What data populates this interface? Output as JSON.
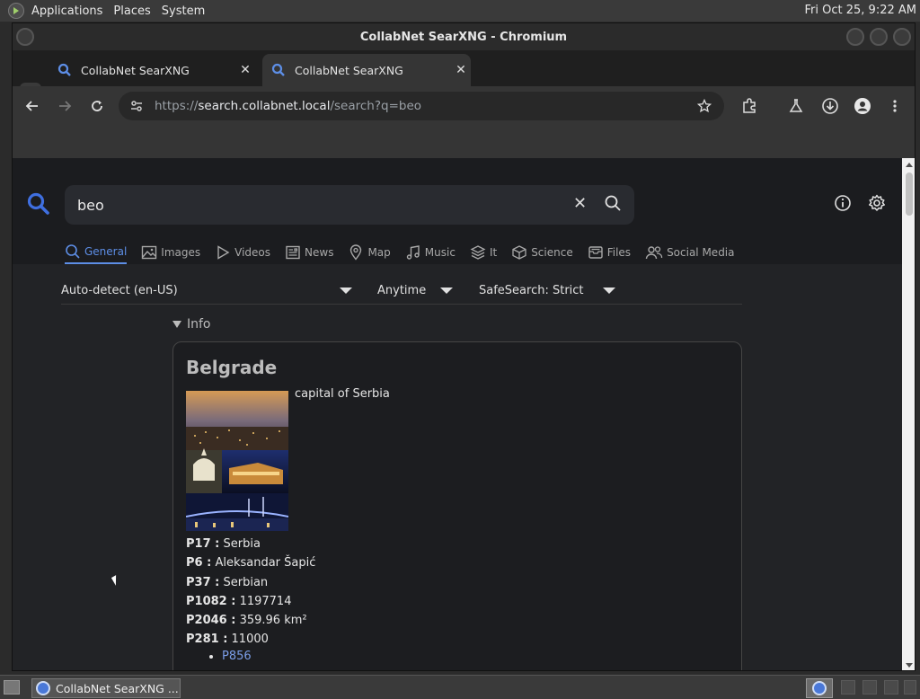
{
  "top_panel": {
    "menus": [
      "Applications",
      "Places",
      "System"
    ],
    "clock": "Fri Oct 25,  9:22 AM"
  },
  "window": {
    "title": "CollabNet SearXNG - Chromium"
  },
  "tabs": [
    {
      "title": "CollabNet SearXNG",
      "active": false
    },
    {
      "title": "CollabNet SearXNG",
      "active": true
    }
  ],
  "address_bar": {
    "scheme": "https://",
    "host": "search.collabnet.local",
    "path": "/search?q=beo"
  },
  "search": {
    "query": "beo"
  },
  "categories": [
    {
      "label": "General",
      "icon": "search-icon",
      "active": true
    },
    {
      "label": "Images",
      "icon": "image-icon",
      "active": false
    },
    {
      "label": "Videos",
      "icon": "play-icon",
      "active": false
    },
    {
      "label": "News",
      "icon": "newspaper-icon",
      "active": false
    },
    {
      "label": "Map",
      "icon": "map-pin-icon",
      "active": false
    },
    {
      "label": "Music",
      "icon": "music-icon",
      "active": false
    },
    {
      "label": "It",
      "icon": "layers-icon",
      "active": false
    },
    {
      "label": "Science",
      "icon": "cube-icon",
      "active": false
    },
    {
      "label": "Files",
      "icon": "archive-icon",
      "active": false
    },
    {
      "label": "Social Media",
      "icon": "people-icon",
      "active": false
    }
  ],
  "filters": {
    "language": "Auto-detect (en-US)",
    "time_range": "Anytime",
    "safesearch": "SafeSearch: Strict"
  },
  "infobox": {
    "toggle_label": "Info",
    "title": "Belgrade",
    "description": "capital of Serbia",
    "attributes": [
      {
        "key": "P17 :",
        "value": "Serbia"
      },
      {
        "key": "P6 :",
        "value": "Aleksandar Šapić"
      },
      {
        "key": "P37 :",
        "value": "Serbian"
      },
      {
        "key": "P1082 :",
        "value": "1197714"
      },
      {
        "key": "P2046 :",
        "value": "359.96 km²"
      },
      {
        "key": "P281 :",
        "value": "11000"
      }
    ],
    "links": [
      "P856"
    ]
  },
  "taskbar": {
    "task_label": "CollabNet SearXNG ..."
  },
  "colors": {
    "accent": "#5d8ee6",
    "page_bg": "#222326",
    "header_bg": "#1b1c1f"
  }
}
